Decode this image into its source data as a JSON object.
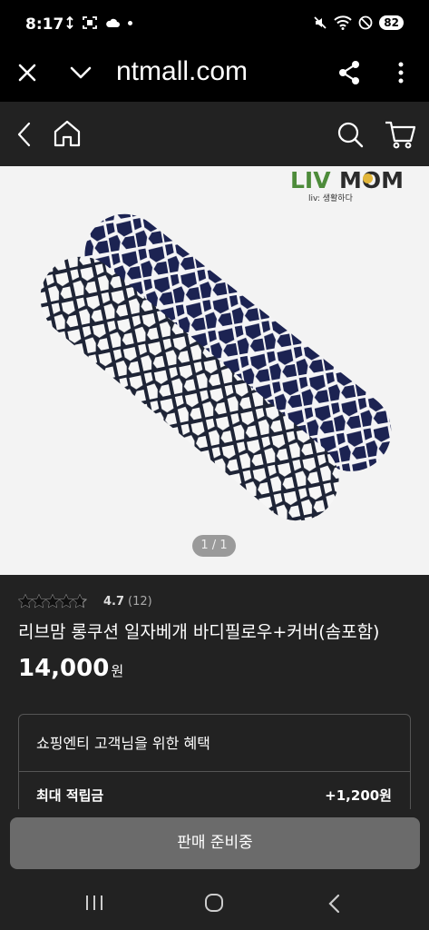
{
  "status_bar": {
    "time": "8:17",
    "battery": "82"
  },
  "browser": {
    "url": "ntmall.com",
    "icons": [
      "close-icon",
      "chevron-down-icon",
      "share-icon",
      "more-vert-icon"
    ]
  },
  "site_header": {
    "icons": [
      "back-icon",
      "home-icon",
      "search-icon",
      "cart-icon"
    ]
  },
  "product": {
    "brand_logo_text": "LIV MOM",
    "brand_logo_sub": "liv: 생활하다",
    "image_pager": "1 / 1",
    "rating_value": "4.7",
    "rating_count": "(12)",
    "rating_stars": 4.7,
    "title": "리브맘 롱쿠션 일자베개 바디필로우+커버(솜포함)",
    "price": "14,000",
    "price_unit": "원"
  },
  "benefits": {
    "heading": "쇼핑엔티 고객님을 위한 혜택",
    "max_points_label": "최대 적립금",
    "max_points_value": "+1,200원"
  },
  "action": {
    "button_label": "판매 준비중"
  },
  "colors": {
    "page_bg": "#222222",
    "button_bg": "#6b6b6b",
    "pillow_navy": "#1c2352",
    "logo_yellow": "#e2b63a",
    "logo_green": "#4d8b3a"
  }
}
